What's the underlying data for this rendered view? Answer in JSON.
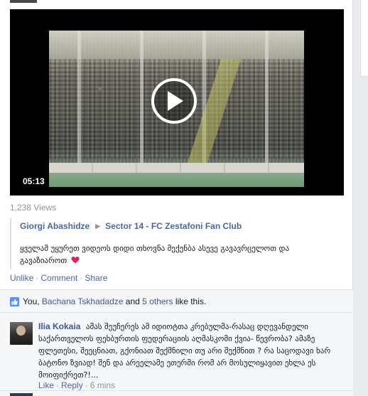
{
  "video": {
    "duration": "05:13",
    "play_icon": "play-icon"
  },
  "views": "1,238 Views",
  "share": {
    "author": "Giorgi Abashidze",
    "arrow_icon": "triangle-right-icon",
    "target": "Sector 14 - FC Zestafoni Fan Club",
    "text": "ყველამ უყურეთ ვიდეოს დიდი თხოვნა მექენბა ასევე გავავრცელოთ და გავაზიაროთ",
    "heart_icon": "heart-icon",
    "heart_color": "#e0245e"
  },
  "actions": {
    "unlike": "Unlike",
    "comment": "Comment",
    "share": "Share",
    "separator": "·"
  },
  "likes": {
    "icon": "thumbs-up-icon",
    "you": "You, ",
    "name": "Bachana Tskhadadze",
    "and": " and ",
    "others": "5 others",
    "suffix": " like this."
  },
  "comment": {
    "author": "Ilia Kokaia",
    "text": "ამას შეუჩერეს ამ იდიოტთა კრებულმა-რასაც დღევანდელი საქართველოს ფეხბურთის ფედერაციის აღმასკომი ქვია- წევრობა? ამაზე ფლეთესი, შეეცნიათ, გქონიათ შექმნილი თუ არი შექმნით ? რა საცოდავი ხარ ბატონო ზვიად! შენ და არეელამე ეთერში რომ არ მოსულიყავით ეხლა ეს მოიფიქრეთ?!...",
    "like": "Like",
    "reply": "Reply",
    "time": "6 mins",
    "separator": "·"
  },
  "colors": {
    "link": "#3b5998",
    "muted": "#90949c",
    "ufi_bg": "#f6f7f9"
  }
}
